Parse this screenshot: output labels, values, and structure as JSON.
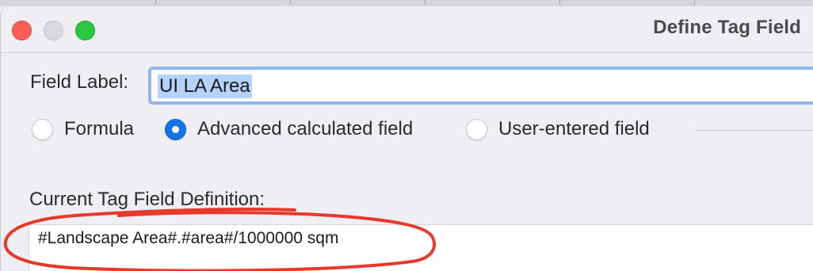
{
  "window": {
    "title": "Define Tag Field"
  },
  "form": {
    "field_label_caption": "Field Label:",
    "field_label_value": "UI LA Area",
    "field_types": [
      {
        "label": "Formula",
        "selected": false
      },
      {
        "label": "Advanced calculated field",
        "selected": true
      },
      {
        "label": "User-entered field",
        "selected": false
      }
    ],
    "definition_caption": "Current Tag Field Definition:",
    "definition_value": "#Landscape Area#.#area#/1000000 sqm"
  },
  "colors": {
    "accent": "#1473e6",
    "selection_highlight": "#b3d3fb",
    "focus_ring": "#8db6ee",
    "annotation_red": "#e8382c",
    "close_button": "#ff5f57",
    "zoom_button": "#28c840"
  },
  "icons": {
    "close": "close-traffic-light",
    "minimize": "minimize-traffic-light",
    "zoom": "zoom-traffic-light"
  }
}
